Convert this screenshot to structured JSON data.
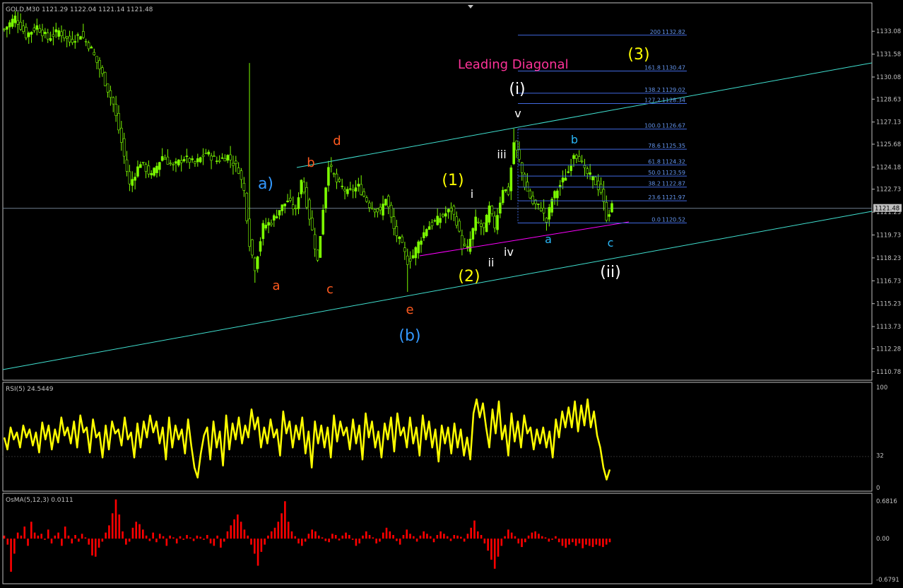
{
  "header": {
    "main_title": "GOLD,M30  1121.29 1122.04 1121.14 1121.48",
    "rsi_title": "RSI(5) 24.5449",
    "osma_title": "OsMA(5,12,3) 0.0111"
  },
  "colors": {
    "background": "#000000",
    "frame": "#c0c0c0",
    "candle": "#7cfc00",
    "channel": "#40e0d0",
    "fib": "#4169e1",
    "fib_text": "#6495ed",
    "diagonal_line": "#ff00ff",
    "rsi_line": "#ffff00",
    "osma_bars": "#ff0000",
    "wave_orange": "#ff5a1f",
    "wave_blue": "#3399ff",
    "wave_yellow": "#ffff00",
    "wave_white": "#ffffff",
    "wave_cyan": "#29b6f6",
    "leading_diag_text": "#ff3399"
  },
  "main_axis": {
    "tick_labels": [
      "1133.08",
      "1131.58",
      "1130.08",
      "1128.63",
      "1127.13",
      "1125.68",
      "1124.18",
      "1122.73",
      "1121.23",
      "1119.73",
      "1118.23",
      "1116.73",
      "1115.23",
      "1113.73",
      "1112.28",
      "1110.78"
    ],
    "current_price": "1121.48"
  },
  "rsi_axis": {
    "tick_labels": [
      "100",
      "32",
      "0"
    ]
  },
  "osma_axis": {
    "tick_labels": [
      "0.6816",
      "0.00",
      "-0.6791"
    ]
  },
  "annotation_text": "Leading Diagonal",
  "wave_labels": [
    {
      "text": "a)",
      "color": "wave_blue"
    },
    {
      "text": "a",
      "color": "wave_orange"
    },
    {
      "text": "b",
      "color": "wave_orange"
    },
    {
      "text": "c",
      "color": "wave_orange"
    },
    {
      "text": "d",
      "color": "wave_orange"
    },
    {
      "text": "e",
      "color": "wave_orange"
    },
    {
      "text": "(b)",
      "color": "wave_blue"
    },
    {
      "text": "(1)",
      "color": "wave_yellow"
    },
    {
      "text": "(2)",
      "color": "wave_yellow"
    },
    {
      "text": "(3)",
      "color": "wave_yellow"
    },
    {
      "text": "i",
      "color": "wave_white"
    },
    {
      "text": "ii",
      "color": "wave_white"
    },
    {
      "text": "iii",
      "color": "wave_white"
    },
    {
      "text": "iv",
      "color": "wave_white"
    },
    {
      "text": "v",
      "color": "wave_white"
    },
    {
      "text": "(i)",
      "color": "wave_white"
    },
    {
      "text": "(ii)",
      "color": "wave_white"
    },
    {
      "text": "a",
      "color": "wave_cyan"
    },
    {
      "text": "b",
      "color": "wave_cyan"
    },
    {
      "text": "c",
      "color": "wave_cyan"
    }
  ],
  "fib_levels": [
    {
      "ratio": "200",
      "price": "1132.82"
    },
    {
      "ratio": "161.8",
      "price": "1130.47"
    },
    {
      "ratio": "138.2",
      "price": "1129.02"
    },
    {
      "ratio": "127.2",
      "price": "1128.34"
    },
    {
      "ratio": "100.0",
      "price": "1126.67"
    },
    {
      "ratio": "78.6",
      "price": "1125.35"
    },
    {
      "ratio": "61.8",
      "price": "1124.32"
    },
    {
      "ratio": "50.0",
      "price": "1123.59"
    },
    {
      "ratio": "38.2",
      "price": "1122.87"
    },
    {
      "ratio": "23.6",
      "price": "1121.97"
    },
    {
      "ratio": "0.0",
      "price": "1120.52"
    }
  ],
  "chart_data": [
    {
      "type": "candlestick",
      "title": "GOLD,M30",
      "ylim": [
        1110.4,
        1134.2
      ],
      "price_anchors": [
        [
          0,
          1133.2
        ],
        [
          4,
          1134.0
        ],
        [
          8,
          1132.8
        ],
        [
          12,
          1133.4
        ],
        [
          16,
          1132.6
        ],
        [
          20,
          1133.1
        ],
        [
          24,
          1132.4
        ],
        [
          28,
          1132.9
        ],
        [
          32,
          1131.9
        ],
        [
          36,
          1130.2
        ],
        [
          40,
          1128.3
        ],
        [
          43,
          1125.8
        ],
        [
          46,
          1123.0
        ],
        [
          50,
          1124.5
        ],
        [
          54,
          1123.6
        ],
        [
          58,
          1124.9
        ],
        [
          62,
          1124.2
        ],
        [
          66,
          1124.8
        ],
        [
          70,
          1124.4
        ],
        [
          74,
          1125.1
        ],
        [
          78,
          1124.6
        ],
        [
          82,
          1124.9
        ],
        [
          86,
          1124.0
        ],
        [
          88,
          1122.6
        ],
        [
          90,
          1119.2
        ],
        [
          92,
          1117.6
        ],
        [
          95,
          1120.3
        ],
        [
          98,
          1120.6
        ],
        [
          101,
          1121.4
        ],
        [
          104,
          1122.0
        ],
        [
          107,
          1121.3
        ],
        [
          109,
          1123.4
        ],
        [
          111,
          1121.8
        ],
        [
          113,
          1120.0
        ],
        [
          115,
          1118.0
        ],
        [
          117,
          1121.5
        ],
        [
          119,
          1124.4
        ],
        [
          122,
          1123.2
        ],
        [
          126,
          1122.5
        ],
        [
          130,
          1122.9
        ],
        [
          134,
          1121.7
        ],
        [
          138,
          1121.2
        ],
        [
          140,
          1122.2
        ],
        [
          143,
          1120.1
        ],
        [
          146,
          1119.0
        ],
        [
          148,
          1118.0
        ],
        [
          150,
          1118.4
        ],
        [
          152,
          1119.2
        ],
        [
          155,
          1120.2
        ],
        [
          158,
          1120.6
        ],
        [
          161,
          1121.0
        ],
        [
          164,
          1121.4
        ],
        [
          166,
          1120.6
        ],
        [
          168,
          1119.0
        ],
        [
          170,
          1118.8
        ],
        [
          173,
          1120.7
        ],
        [
          176,
          1120.1
        ],
        [
          178,
          1121.5
        ],
        [
          180,
          1120.3
        ],
        [
          183,
          1122.8
        ],
        [
          185,
          1122.5
        ],
        [
          187,
          1125.8
        ],
        [
          189,
          1124.6
        ],
        [
          191,
          1123.0
        ],
        [
          194,
          1121.8
        ],
        [
          197,
          1121.5
        ],
        [
          199,
          1120.6
        ],
        [
          201,
          1122.1
        ],
        [
          204,
          1123.0
        ],
        [
          207,
          1123.9
        ],
        [
          209,
          1125.1
        ],
        [
          211,
          1124.8
        ],
        [
          213,
          1123.9
        ],
        [
          216,
          1123.4
        ],
        [
          219,
          1122.6
        ],
        [
          221,
          1120.9
        ],
        [
          223,
          1121.6
        ]
      ]
    },
    {
      "type": "line",
      "title": "RSI(5)",
      "ylim": [
        0,
        100
      ],
      "values": [
        50,
        38,
        60,
        48,
        55,
        40,
        62,
        50,
        58,
        42,
        55,
        35,
        65,
        48,
        62,
        38,
        58,
        45,
        70,
        52,
        60,
        44,
        66,
        40,
        72,
        55,
        60,
        35,
        68,
        50,
        55,
        30,
        62,
        38,
        66,
        54,
        58,
        42,
        70,
        48,
        55,
        30,
        64,
        40,
        66,
        50,
        72,
        55,
        66,
        44,
        60,
        28,
        70,
        40,
        62,
        48,
        58,
        34,
        68,
        42,
        20,
        10,
        34,
        52,
        60,
        28,
        66,
        40,
        56,
        22,
        72,
        38,
        64,
        48,
        70,
        44,
        62,
        50,
        78,
        58,
        70,
        40,
        60,
        44,
        68,
        50,
        58,
        32,
        76,
        54,
        66,
        40,
        62,
        48,
        70,
        34,
        56,
        20,
        66,
        44,
        62,
        40,
        60,
        30,
        72,
        46,
        66,
        52,
        60,
        38,
        68,
        44,
        62,
        28,
        74,
        50,
        66,
        40,
        56,
        30,
        64,
        48,
        70,
        36,
        74,
        52,
        60,
        40,
        70,
        44,
        60,
        32,
        72,
        48,
        66,
        40,
        58,
        26,
        62,
        44,
        60,
        34,
        64,
        40,
        58,
        32,
        50,
        28,
        74,
        88,
        70,
        84,
        60,
        40,
        78,
        54,
        86,
        48,
        62,
        32,
        74,
        46,
        66,
        40,
        72,
        54,
        60,
        38,
        58,
        44,
        60,
        40,
        56,
        30,
        68,
        50,
        76,
        60,
        80,
        60,
        86,
        56,
        82,
        62,
        88,
        60,
        76,
        52,
        40,
        20,
        8,
        18
      ]
    },
    {
      "type": "bar",
      "title": "OsMA(5,12,3)",
      "ylim": [
        -0.6791,
        0.6816
      ],
      "values": [
        0.05,
        -0.1,
        -0.55,
        -0.25,
        0.1,
        0.05,
        0.2,
        -0.12,
        0.28,
        0.1,
        0.05,
        0.08,
        -0.02,
        0.15,
        -0.08,
        0.05,
        0.1,
        -0.12,
        0.2,
        0.05,
        -0.08,
        0.06,
        -0.05,
        0.08,
        0.02,
        -0.1,
        -0.28,
        -0.3,
        -0.15,
        -0.05,
        0.1,
        0.22,
        0.42,
        0.65,
        0.4,
        0.12,
        -0.1,
        -0.05,
        0.18,
        0.28,
        0.24,
        0.15,
        0.05,
        -0.04,
        0.1,
        -0.06,
        0.08,
        0.04,
        -0.12,
        0.05,
        0.02,
        -0.08,
        0.04,
        -0.02,
        0.06,
        0.02,
        -0.04,
        0.05,
        0.03,
        -0.02,
        0.06,
        -0.08,
        -0.12,
        0.05,
        -0.15,
        -0.05,
        0.12,
        0.22,
        0.32,
        0.4,
        0.28,
        0.15,
        0.05,
        -0.1,
        -0.25,
        -0.45,
        -0.22,
        -0.1,
        0.05,
        0.12,
        0.18,
        0.28,
        0.42,
        0.62,
        0.28,
        0.12,
        0.04,
        -0.08,
        -0.12,
        -0.05,
        0.08,
        0.15,
        0.12,
        0.05,
        0.02,
        -0.04,
        -0.06,
        0.08,
        0.06,
        -0.03,
        0.05,
        0.1,
        0.06,
        -0.02,
        -0.12,
        -0.08,
        0.05,
        0.12,
        0.06,
        0.02,
        -0.08,
        -0.05,
        0.1,
        0.18,
        0.12,
        0.06,
        -0.04,
        -0.1,
        0.06,
        0.15,
        0.08,
        0.04,
        -0.05,
        0.05,
        0.12,
        0.08,
        0.04,
        -0.06,
        0.06,
        0.12,
        0.08,
        0.04,
        -0.04,
        0.06,
        0.05,
        0.03,
        -0.05,
        0.08,
        0.18,
        0.3,
        0.12,
        0.06,
        -0.08,
        -0.2,
        -0.35,
        -0.5,
        -0.3,
        -0.12,
        0.04,
        0.15,
        0.1,
        0.04,
        -0.08,
        -0.14,
        -0.06,
        0.05,
        0.1,
        0.12,
        0.08,
        0.04,
        0.02,
        -0.05,
        -0.02,
        0.04,
        -0.06,
        -0.12,
        -0.15,
        -0.1,
        -0.06,
        -0.12,
        -0.08,
        -0.16,
        -0.1,
        -0.12,
        -0.14,
        -0.1,
        -0.12,
        -0.14,
        -0.1,
        -0.06
      ]
    }
  ]
}
